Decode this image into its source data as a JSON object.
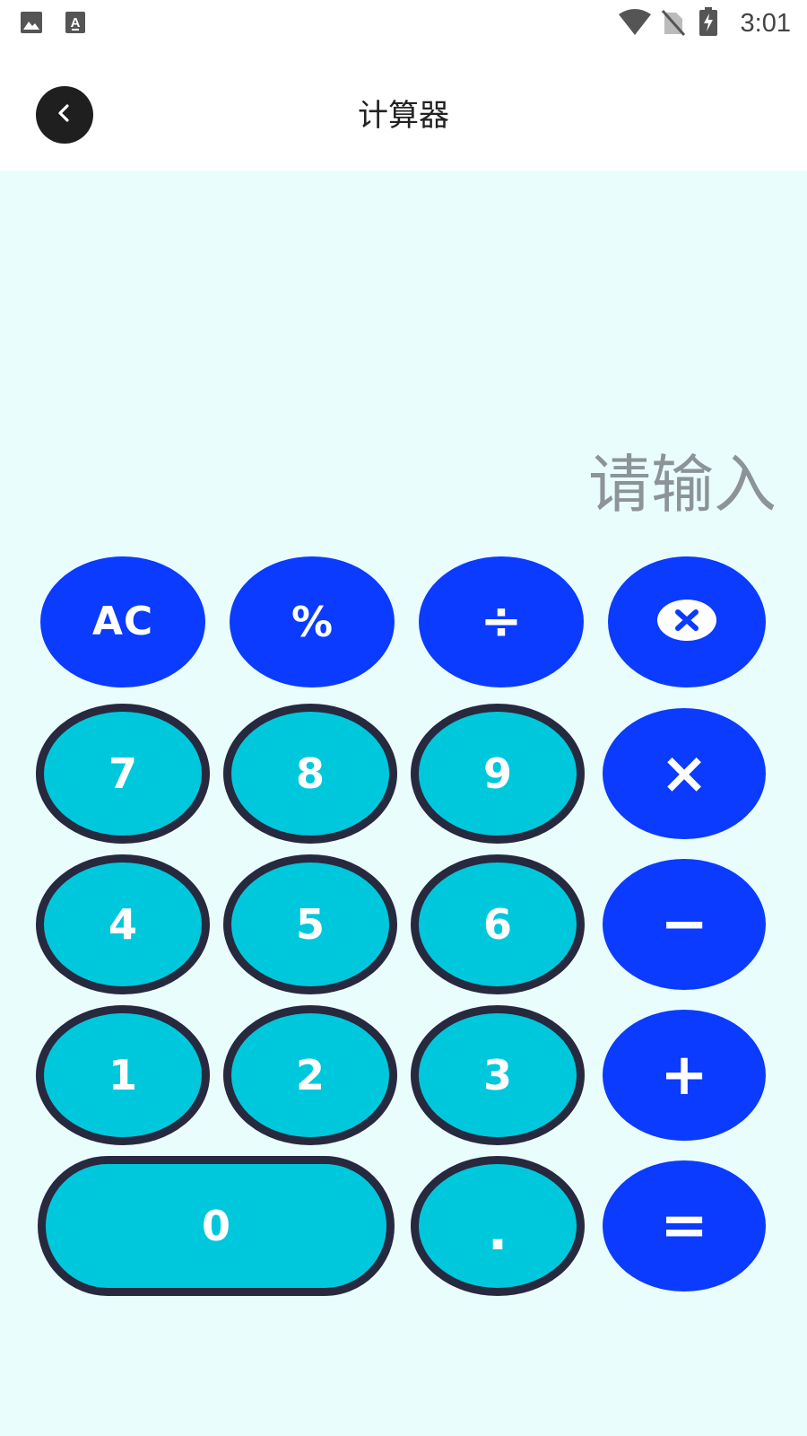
{
  "status_bar": {
    "time": "3:01",
    "icons": [
      "image-icon",
      "text-a-icon",
      "wifi-icon",
      "no-sim-icon",
      "battery-charging-icon"
    ]
  },
  "header": {
    "title": "计算器",
    "back_icon": "chevron-left-icon"
  },
  "display": {
    "placeholder": "请输入"
  },
  "keypad": {
    "ac": "AC",
    "percent": "%",
    "divide": "÷",
    "backspace_icon": "backspace-circle-x-icon",
    "seven": "7",
    "eight": "8",
    "nine": "9",
    "multiply": "×",
    "four": "4",
    "five": "5",
    "six": "6",
    "minus": "−",
    "one": "1",
    "two": "2",
    "three": "3",
    "plus": "+",
    "zero": "0",
    "dot": ".",
    "equals": "="
  },
  "colors": {
    "operator_key": "#0a3bff",
    "number_key": "#00c8dc",
    "number_key_border": "#27293f",
    "background": "#eafdfd"
  }
}
